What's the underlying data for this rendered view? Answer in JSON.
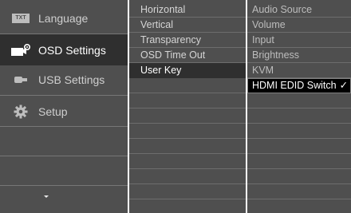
{
  "main_menu": {
    "items": [
      {
        "label": "Language",
        "icon": "txt-icon",
        "icon_text": "TXT"
      },
      {
        "label": "OSD Settings",
        "icon": "osd-settings-icon",
        "selected": true
      },
      {
        "label": "USB Settings",
        "icon": "usb-icon"
      },
      {
        "label": "Setup",
        "icon": "gear-icon"
      }
    ],
    "scroll_indicator": "down-arrow"
  },
  "sub_menu": {
    "items": [
      {
        "label": "Horizontal"
      },
      {
        "label": "Vertical"
      },
      {
        "label": "Transparency"
      },
      {
        "label": "OSD Time Out"
      },
      {
        "label": "User Key",
        "selected": true
      }
    ]
  },
  "options": {
    "items": [
      {
        "label": "Audio Source"
      },
      {
        "label": "Volume"
      },
      {
        "label": "Input"
      },
      {
        "label": "Brightness"
      },
      {
        "label": "KVM"
      },
      {
        "label": "HDMI EDID Switch",
        "highlighted": true,
        "checked": true,
        "check_mark": "✓"
      }
    ]
  },
  "colors": {
    "panel": "#4f4f4f",
    "selected_row": "#2f2f2f",
    "highlight": "#000000",
    "text": "#d5d5d5"
  }
}
